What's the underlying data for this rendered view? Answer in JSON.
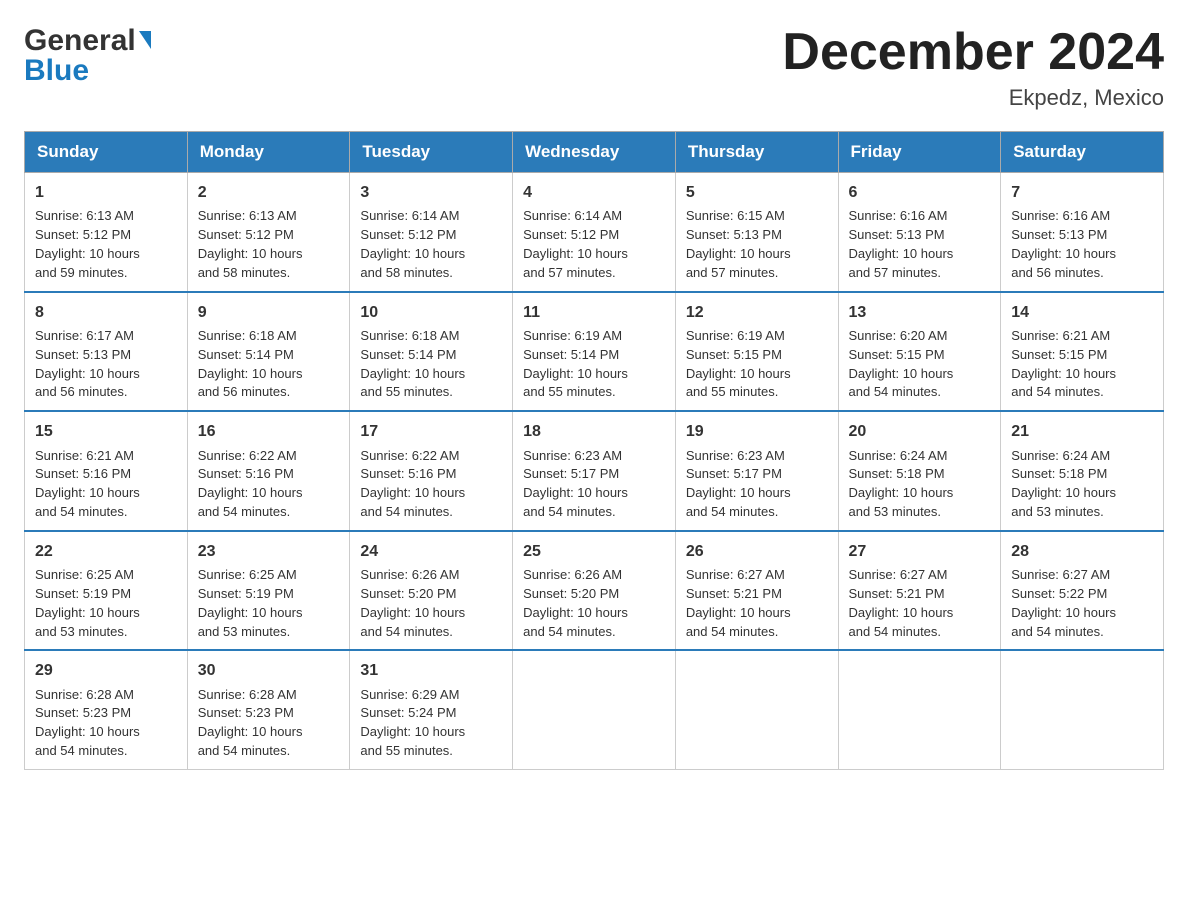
{
  "header": {
    "logo_general": "General",
    "logo_blue": "Blue",
    "month_title": "December 2024",
    "location": "Ekpedz, Mexico"
  },
  "days_of_week": [
    "Sunday",
    "Monday",
    "Tuesday",
    "Wednesday",
    "Thursday",
    "Friday",
    "Saturday"
  ],
  "weeks": [
    [
      {
        "day": "1",
        "sunrise": "6:13 AM",
        "sunset": "5:12 PM",
        "daylight": "10 hours and 59 minutes."
      },
      {
        "day": "2",
        "sunrise": "6:13 AM",
        "sunset": "5:12 PM",
        "daylight": "10 hours and 58 minutes."
      },
      {
        "day": "3",
        "sunrise": "6:14 AM",
        "sunset": "5:12 PM",
        "daylight": "10 hours and 58 minutes."
      },
      {
        "day": "4",
        "sunrise": "6:14 AM",
        "sunset": "5:12 PM",
        "daylight": "10 hours and 57 minutes."
      },
      {
        "day": "5",
        "sunrise": "6:15 AM",
        "sunset": "5:13 PM",
        "daylight": "10 hours and 57 minutes."
      },
      {
        "day": "6",
        "sunrise": "6:16 AM",
        "sunset": "5:13 PM",
        "daylight": "10 hours and 57 minutes."
      },
      {
        "day": "7",
        "sunrise": "6:16 AM",
        "sunset": "5:13 PM",
        "daylight": "10 hours and 56 minutes."
      }
    ],
    [
      {
        "day": "8",
        "sunrise": "6:17 AM",
        "sunset": "5:13 PM",
        "daylight": "10 hours and 56 minutes."
      },
      {
        "day": "9",
        "sunrise": "6:18 AM",
        "sunset": "5:14 PM",
        "daylight": "10 hours and 56 minutes."
      },
      {
        "day": "10",
        "sunrise": "6:18 AM",
        "sunset": "5:14 PM",
        "daylight": "10 hours and 55 minutes."
      },
      {
        "day": "11",
        "sunrise": "6:19 AM",
        "sunset": "5:14 PM",
        "daylight": "10 hours and 55 minutes."
      },
      {
        "day": "12",
        "sunrise": "6:19 AM",
        "sunset": "5:15 PM",
        "daylight": "10 hours and 55 minutes."
      },
      {
        "day": "13",
        "sunrise": "6:20 AM",
        "sunset": "5:15 PM",
        "daylight": "10 hours and 54 minutes."
      },
      {
        "day": "14",
        "sunrise": "6:21 AM",
        "sunset": "5:15 PM",
        "daylight": "10 hours and 54 minutes."
      }
    ],
    [
      {
        "day": "15",
        "sunrise": "6:21 AM",
        "sunset": "5:16 PM",
        "daylight": "10 hours and 54 minutes."
      },
      {
        "day": "16",
        "sunrise": "6:22 AM",
        "sunset": "5:16 PM",
        "daylight": "10 hours and 54 minutes."
      },
      {
        "day": "17",
        "sunrise": "6:22 AM",
        "sunset": "5:16 PM",
        "daylight": "10 hours and 54 minutes."
      },
      {
        "day": "18",
        "sunrise": "6:23 AM",
        "sunset": "5:17 PM",
        "daylight": "10 hours and 54 minutes."
      },
      {
        "day": "19",
        "sunrise": "6:23 AM",
        "sunset": "5:17 PM",
        "daylight": "10 hours and 54 minutes."
      },
      {
        "day": "20",
        "sunrise": "6:24 AM",
        "sunset": "5:18 PM",
        "daylight": "10 hours and 53 minutes."
      },
      {
        "day": "21",
        "sunrise": "6:24 AM",
        "sunset": "5:18 PM",
        "daylight": "10 hours and 53 minutes."
      }
    ],
    [
      {
        "day": "22",
        "sunrise": "6:25 AM",
        "sunset": "5:19 PM",
        "daylight": "10 hours and 53 minutes."
      },
      {
        "day": "23",
        "sunrise": "6:25 AM",
        "sunset": "5:19 PM",
        "daylight": "10 hours and 53 minutes."
      },
      {
        "day": "24",
        "sunrise": "6:26 AM",
        "sunset": "5:20 PM",
        "daylight": "10 hours and 54 minutes."
      },
      {
        "day": "25",
        "sunrise": "6:26 AM",
        "sunset": "5:20 PM",
        "daylight": "10 hours and 54 minutes."
      },
      {
        "day": "26",
        "sunrise": "6:27 AM",
        "sunset": "5:21 PM",
        "daylight": "10 hours and 54 minutes."
      },
      {
        "day": "27",
        "sunrise": "6:27 AM",
        "sunset": "5:21 PM",
        "daylight": "10 hours and 54 minutes."
      },
      {
        "day": "28",
        "sunrise": "6:27 AM",
        "sunset": "5:22 PM",
        "daylight": "10 hours and 54 minutes."
      }
    ],
    [
      {
        "day": "29",
        "sunrise": "6:28 AM",
        "sunset": "5:23 PM",
        "daylight": "10 hours and 54 minutes."
      },
      {
        "day": "30",
        "sunrise": "6:28 AM",
        "sunset": "5:23 PM",
        "daylight": "10 hours and 54 minutes."
      },
      {
        "day": "31",
        "sunrise": "6:29 AM",
        "sunset": "5:24 PM",
        "daylight": "10 hours and 55 minutes."
      },
      null,
      null,
      null,
      null
    ]
  ],
  "labels": {
    "sunrise": "Sunrise:",
    "sunset": "Sunset:",
    "daylight": "Daylight:"
  }
}
